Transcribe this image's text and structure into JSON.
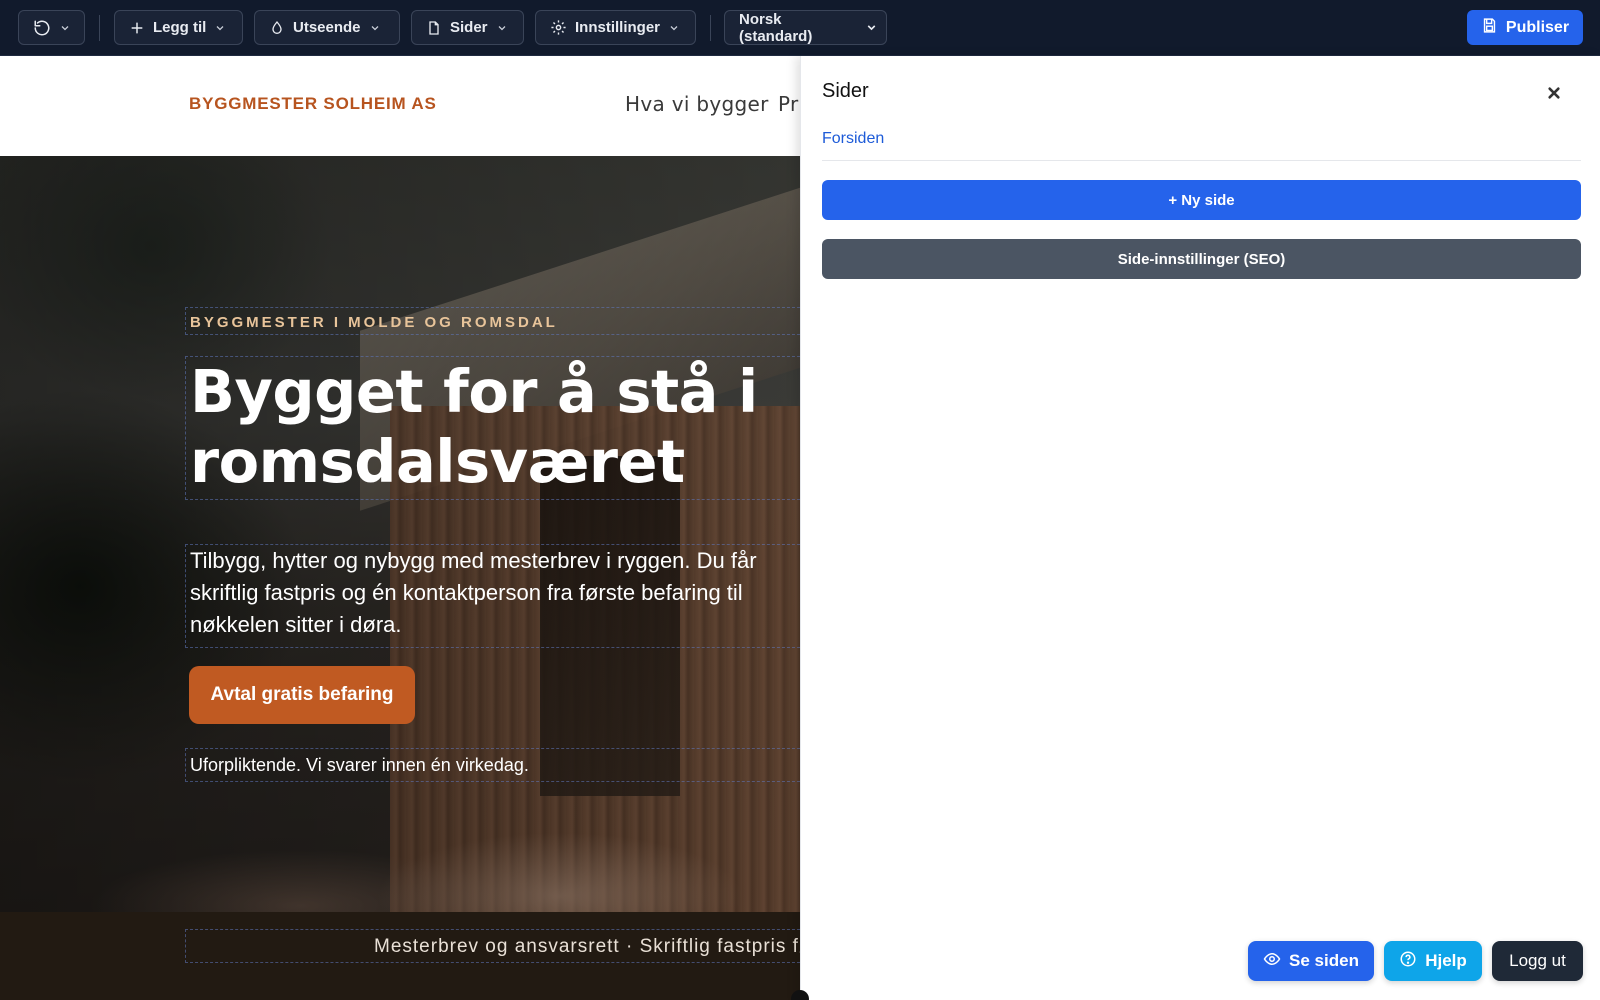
{
  "toolbar": {
    "undo_icon": "undo-icon",
    "add_label": "Legg til",
    "appearance_label": "Utseende",
    "pages_label": "Sider",
    "settings_label": "Innstillinger",
    "language_value": "Norsk (standard)",
    "publish_label": "Publiser"
  },
  "site": {
    "brand": "BYGGMESTER SOLHEIM AS",
    "nav": [
      "Hva vi bygger",
      "Pr"
    ],
    "hero": {
      "eyebrow": "BYGGMESTER I MOLDE OG ROMSDAL",
      "title_line1": "Bygget for å stå i",
      "title_line2": "romsdalsværet",
      "lead_line1": "Tilbygg, hytter og nybygg med mesterbrev i ryggen. Du får",
      "lead_line2": "skriftlig fastpris og én kontaktperson fra første befaring til",
      "lead_line3": "nøkkelen sitter i døra.",
      "cta": "Avtal gratis befaring",
      "note": "Uforpliktende. Vi svarer innen én virkedag."
    },
    "trustbar": "Mesterbrev og ansvarsrett  ·  Skriftlig fastpris fø"
  },
  "panel": {
    "title": "Sider",
    "pages": [
      "Forsiden"
    ],
    "new_page_label": "+ Ny side",
    "seo_label": "Side-innstillinger (SEO)"
  },
  "floating": {
    "view_label": "Se siden",
    "help_label": "Hjelp",
    "logout_label": "Logg ut"
  },
  "colors": {
    "toolbar_bg": "#111a2c",
    "primary": "#2563eb",
    "brand": "#b7541f",
    "cta": "#c05a22",
    "help": "#0ea5e9"
  }
}
